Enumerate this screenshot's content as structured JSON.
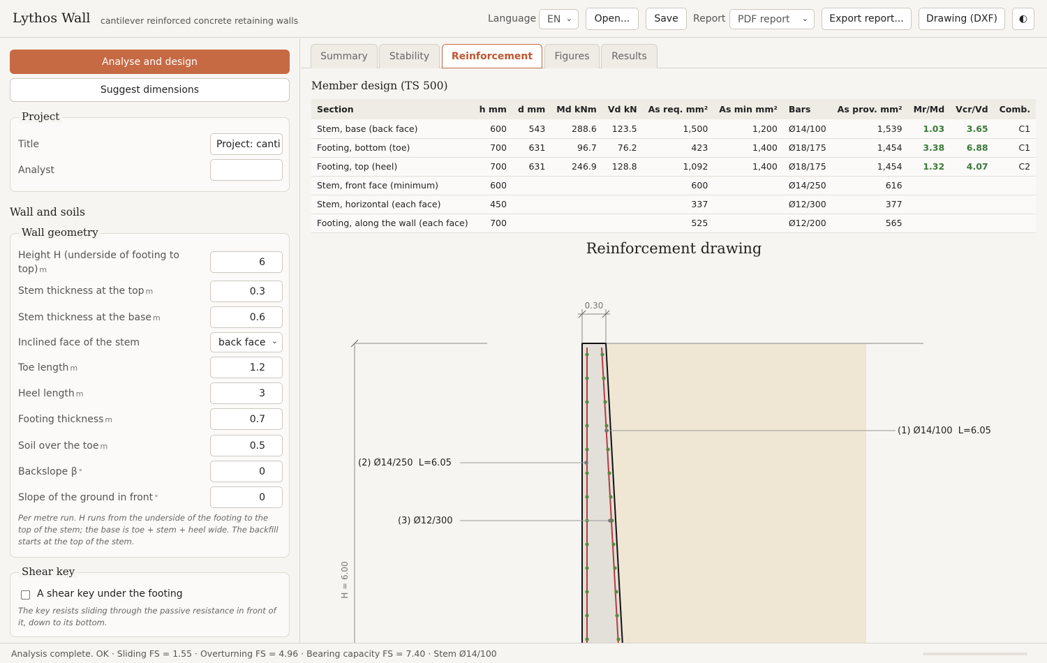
{
  "header": {
    "title": "Lythos Wall",
    "subtitle": "cantilever reinforced concrete retaining walls",
    "language_label": "Language",
    "language_value": "EN",
    "open_label": "Open...",
    "save_label": "Save",
    "report_label": "Report",
    "report_value": "PDF report",
    "export_label": "Export report...",
    "dxf_label": "Drawing (DXF)",
    "theme_icon": "◐"
  },
  "sidebar": {
    "analyse_label": "Analyse and design",
    "suggest_label": "Suggest dimensions",
    "project": {
      "legend": "Project",
      "title_label": "Title",
      "title_value": "Project: canti",
      "analyst_label": "Analyst",
      "analyst_value": ""
    },
    "wall_soils_title": "Wall and soils",
    "geometry": {
      "legend": "Wall geometry",
      "fields": [
        {
          "label": "Height H (underside of footing to top)",
          "unit": "m",
          "value": "6"
        },
        {
          "label": "Stem thickness at the top",
          "unit": "m",
          "value": "0.3"
        },
        {
          "label": "Stem thickness at the base",
          "unit": "m",
          "value": "0.6"
        },
        {
          "label": "Inclined face of the stem",
          "unit": "",
          "value": "back face"
        },
        {
          "label": "Toe length",
          "unit": "m",
          "value": "1.2"
        },
        {
          "label": "Heel length",
          "unit": "m",
          "value": "3"
        },
        {
          "label": "Footing thickness",
          "unit": "m",
          "value": "0.7"
        },
        {
          "label": "Soil over the toe",
          "unit": "m",
          "value": "0.5"
        },
        {
          "label": "Backslope β",
          "unit": "°",
          "value": "0"
        },
        {
          "label": "Slope of the ground in front",
          "unit": "°",
          "value": "0"
        }
      ],
      "note": "Per metre run. H runs from the underside of the footing to the top of the stem; the base is toe + stem + heel wide. The backfill starts at the top of the stem."
    },
    "shear_key": {
      "legend": "Shear key",
      "checkbox_label": "A shear key under the footing",
      "note": "The key resists sliding through the passive resistance in front of it, down to its bottom."
    }
  },
  "tabs": [
    "Summary",
    "Stability",
    "Reinforcement",
    "Figures",
    "Results"
  ],
  "main": {
    "heading": "Member design (TS 500)",
    "columns": [
      "Section",
      "h mm",
      "d mm",
      "Md kNm",
      "Vd kN",
      "As req. mm²",
      "As min mm²",
      "Bars",
      "As prov. mm²",
      "Mr/Md",
      "Vcr/Vd",
      "Comb."
    ],
    "rows": [
      [
        "Stem, base (back face)",
        "600",
        "543",
        "288.6",
        "123.5",
        "1,500",
        "1,200",
        "Ø14/100",
        "1,539",
        "1.03",
        "3.65",
        "C1"
      ],
      [
        "Footing, bottom (toe)",
        "700",
        "631",
        "96.7",
        "76.2",
        "423",
        "1,400",
        "Ø18/175",
        "1,454",
        "3.38",
        "6.88",
        "C1"
      ],
      [
        "Footing, top (heel)",
        "700",
        "631",
        "246.9",
        "128.8",
        "1,092",
        "1,400",
        "Ø18/175",
        "1,454",
        "1.32",
        "4.07",
        "C2"
      ],
      [
        "Stem, front face (minimum)",
        "600",
        "",
        "",
        "",
        "600",
        "",
        "Ø14/250",
        "616",
        "",
        "",
        ""
      ],
      [
        "Stem, horizontal (each face)",
        "450",
        "",
        "",
        "",
        "337",
        "",
        "Ø12/300",
        "377",
        "",
        "",
        ""
      ],
      [
        "Footing, along the wall (each face)",
        "700",
        "",
        "",
        "",
        "525",
        "",
        "Ø12/200",
        "565",
        "",
        "",
        ""
      ]
    ],
    "drawing": {
      "title": "Reinforcement drawing",
      "dim_top": "0.30",
      "dim_height": "H = 6.00",
      "label_1": "(1) Ø14/100  L=6.05",
      "label_2": "(2) Ø14/250  L=6.05",
      "label_3": "(3) Ø12/300"
    }
  },
  "status": {
    "text": "Analysis complete. OK · Sliding FS = 1.55 · Overturning FS = 4.96 · Bearing capacity FS = 7.40 · Stem Ø14/100"
  },
  "colors": {
    "accent": "#c66a44",
    "ok_green": "#3a7a3a",
    "backfill": "#efe6d4",
    "rebar_red": "#b83a3a",
    "rebar_dot": "#5b8a3a"
  }
}
